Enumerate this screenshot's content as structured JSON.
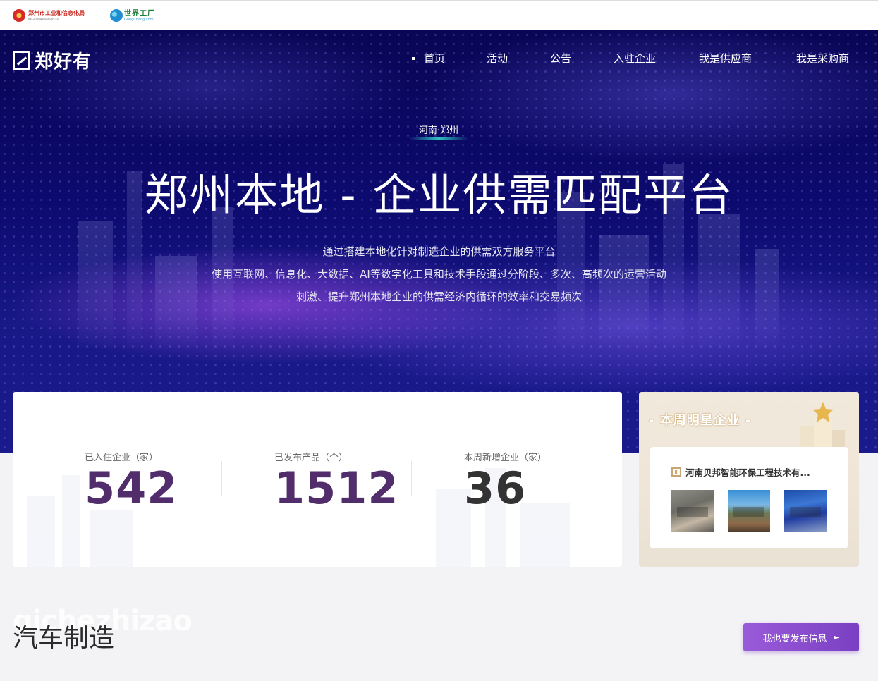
{
  "topbar": {
    "gov_logo": {
      "name": "郑州市工业和信息化局",
      "url": "gxj.zhengzhou.gov.cn"
    },
    "partner_logo": {
      "name": "世界工厂",
      "url": "GongChang.com"
    }
  },
  "header": {
    "brand": "郑好有",
    "nav": [
      "首页",
      "活动",
      "公告",
      "入驻企业",
      "我是供应商",
      "我是采购商"
    ],
    "active_nav": "首页"
  },
  "hero": {
    "region": "河南·郑州",
    "title": "郑州本地 - 企业供需匹配平台",
    "desc": [
      "通过搭建本地化针对制造企业的供需双方服务平台",
      "使用互联网、信息化、大数据、AI等数字化工具和技术手段通过分阶段、多次、高频次的运营活动",
      "刺激、提升郑州本地企业的供需经济内循环的效率和交易频次"
    ]
  },
  "stats": [
    {
      "label": "已入住企业（家）",
      "value": "542"
    },
    {
      "label": "已发布产品（个）",
      "value": "1512"
    },
    {
      "label": "本周新增企业（家）",
      "value": "36"
    }
  ],
  "star_company": {
    "title": "- 本周明星企业 -",
    "company_name": "河南贝邦智能环保工程技术有...",
    "images": [
      "filter-press-machine",
      "outdoor-equipment",
      "blue-conveyor-machine"
    ]
  },
  "section": {
    "bg_word": "qichezhizao",
    "title": "汽车制造",
    "publish_button": "我也要发布信息"
  },
  "colors": {
    "hero_bg": "#0c0a6e",
    "stat_value": "#512e6b",
    "button": "#8a4bd0",
    "gold_accent": "#c9a572"
  }
}
